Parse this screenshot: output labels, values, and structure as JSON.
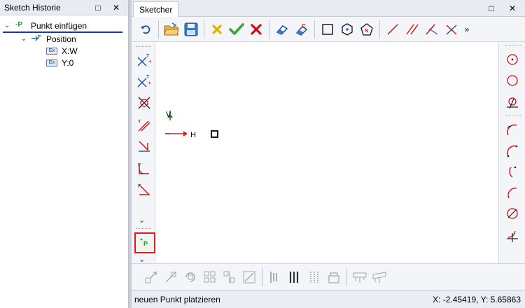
{
  "history_panel": {
    "title": "Sketch Historie",
    "float_icon": "□",
    "close_icon": "✕",
    "tree": [
      {
        "label": "Punkt einfügen",
        "icon_text": "·P"
      },
      {
        "label": "Position"
      },
      {
        "label": "X:W"
      },
      {
        "label": "Y:0"
      }
    ],
    "expr_icon_text": "Ex"
  },
  "sketcher": {
    "tab_label": "Sketcher",
    "float_icon": "□",
    "close_icon": "✕",
    "more_icon": "»",
    "axis_v": "V",
    "axis_h": "H",
    "point_tool_text": "P"
  },
  "status": {
    "message": "neuen Punkt platzieren",
    "coords": "X: -2.45419, Y: 5.65863"
  },
  "colors": {
    "accent_blue": "#1a2fc7",
    "delete_red": "#d01010",
    "confirm_green": "#3aa33a",
    "axis_red": "#cc2222",
    "axis_green": "#228822",
    "highlight": "#e21a1a"
  }
}
